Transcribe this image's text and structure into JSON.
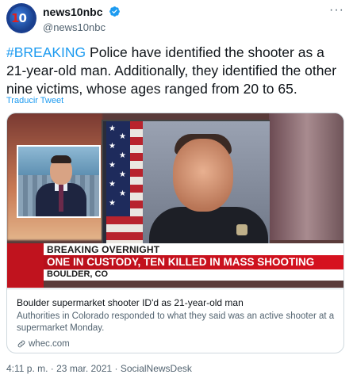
{
  "account": {
    "display_name": "news10nbc",
    "handle": "@news10nbc",
    "avatar_text": "10",
    "verified_icon": "verified-badge-icon",
    "more_icon": "more-options-icon"
  },
  "tweet": {
    "hashtag": "#BREAKING",
    "text": " Police have identified the shooter as a 21-year-old man. Additionally, they identified the other nine victims, whose ages ranged from 20 to 65.",
    "translate_label": "Traducir Tweet"
  },
  "card": {
    "image": {
      "lower_third_top": "BREAKING OVERNIGHT",
      "lower_third_main": "ONE IN CUSTODY, TEN KILLED IN MASS SHOOTING",
      "lower_third_bottom": "BOULDER, CO"
    },
    "title": "Boulder supermarket shooter ID'd as 21-year-old man",
    "description": "Authorities in Colorado responded to what they said was an active shooter at a supermarket Monday.",
    "domain": "whec.com",
    "link_icon": "link-icon"
  },
  "meta": {
    "text": "4:11 p. m. · 23 mar. 2021 · SocialNewsDesk"
  },
  "colors": {
    "accent": "#1d9bf0",
    "text_primary": "#0f1419",
    "text_secondary": "#536471",
    "border": "#cfd9de",
    "breaking_red": "#c0131e"
  }
}
